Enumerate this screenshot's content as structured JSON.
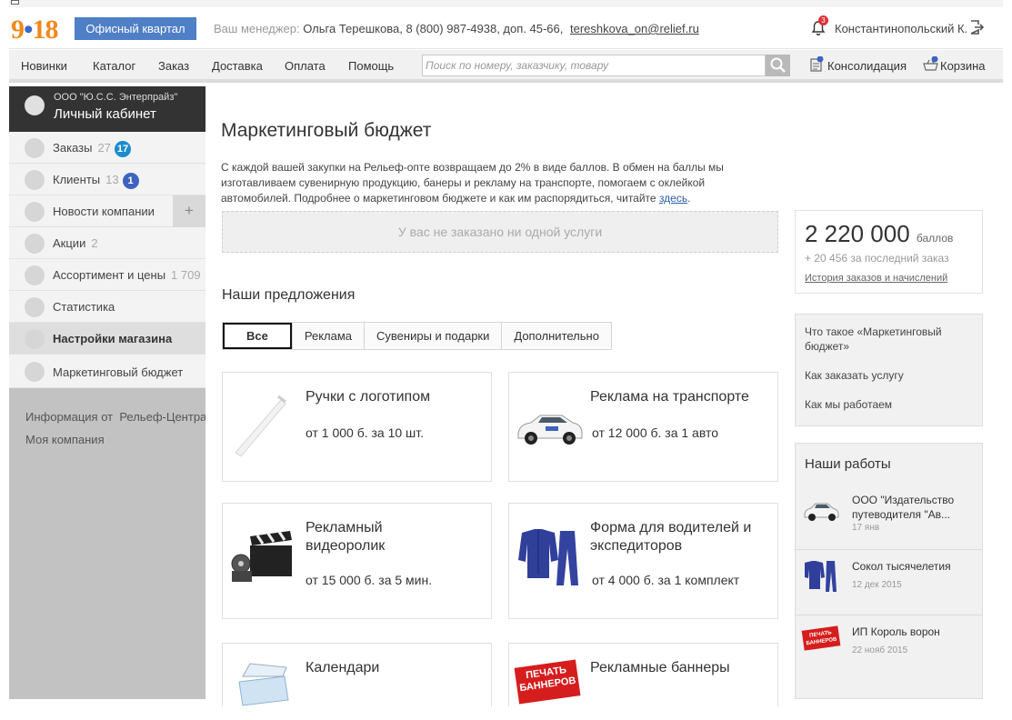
{
  "header": {
    "logo": {
      "left": "9",
      "dot": "•",
      "right": "18"
    },
    "quarter_button": "Офисный квартал",
    "manager_label": "Ваш менеджер:",
    "manager_info": "Ольга Терешкова, 8 (800) 987-4938, доп. 45-66,",
    "manager_email": "tereshkova_on@relief.ru",
    "notifications_count": "3",
    "user_name": "Константинопольский К."
  },
  "nav": {
    "items": [
      "Новинки",
      "Каталог",
      "Заказ",
      "Доставка",
      "Оплата",
      "Помощь"
    ],
    "search_placeholder": "Поиск по номеру, заказчику, товару",
    "consolidation": "Консолидация",
    "cart": "Корзина"
  },
  "sidebar": {
    "org": "ООО \"Ю.С.С. Энтерпрайз\"",
    "cabinet": "Личный кабинет",
    "items": [
      {
        "label": "Заказы",
        "count": "27",
        "badge": "17",
        "badge_color": "#1b8ccd"
      },
      {
        "label": "Клиенты",
        "count": "13",
        "badge": "1",
        "badge_color": "#3d63c0"
      },
      {
        "label": "Новости компании",
        "count": "",
        "badge": ""
      },
      {
        "label": "Акции",
        "count": "2",
        "badge": ""
      },
      {
        "label": "Ассортимент и цены",
        "count": "1 709",
        "badge": ""
      },
      {
        "label": "Статистика",
        "count": "",
        "badge": ""
      },
      {
        "label": "Настройки магазина",
        "count": "",
        "badge": ""
      },
      {
        "label": "Маркетинговый бюджет",
        "count": "",
        "badge": ""
      }
    ],
    "plus": "+",
    "footer_info": "Информация от  Рельеф-Центра",
    "footer_company": "Моя компания"
  },
  "main": {
    "title": "Маркетинговый бюджет",
    "intro": "С каждой вашей закупки на Рельеф-опте возвращаем до 2% в виде баллов. В обмен на баллы мы изготавливаем сувенирную продукцию, банеры и рекламу на транспорте, помогаем с оклейкой автомобилей. Подробнее о маркетинговом бюджете и как им распорядиться, читайте",
    "intro_link": "здесь",
    "empty": "У вас не заказано ни одной услуги",
    "offers_title": "Наши предложения",
    "tabs": [
      "Все",
      "Реклама",
      "Сувениры и подарки",
      "Дополнительно"
    ],
    "cards": [
      {
        "title": "Ручки с логотипом",
        "price": "от 1 000 б. за 10 шт.",
        "icon": "pen-icon"
      },
      {
        "title": "Реклама на транспорте",
        "price": "от 12 000 б. за 1 авто",
        "icon": "car-icon"
      },
      {
        "title": "Рекламный видеоролик",
        "price": "от 15 000 б. за 5 мин.",
        "icon": "clapperboard-icon"
      },
      {
        "title": "Форма для водителей и экспедиторов",
        "price": "от 4 000 б. за 1 комплект",
        "icon": "uniform-icon"
      },
      {
        "title": "Календари",
        "price": "",
        "icon": "calendar-icon"
      },
      {
        "title": "Рекламные баннеры",
        "price": "",
        "icon": "banner-icon"
      }
    ]
  },
  "points": {
    "value": "2 220 000",
    "unit": "баллов",
    "added": "+ 20 456 за последний заказ",
    "history": "История заказов и начислений"
  },
  "faq": [
    "Что такое «Маркетинговый бюджет»",
    "Как заказать услугу",
    "Как мы работаем"
  ],
  "works": {
    "title": "Наши работы",
    "items": [
      {
        "title": "ООО \"Издательство путеводителя \"Ав...",
        "date": "17 янв"
      },
      {
        "title": "Сокол тысячелетия",
        "date": "12 дек 2015"
      },
      {
        "title": "ИП Король ворон",
        "date": "22 нояб 2015"
      }
    ],
    "banner_text_1": "ПЕЧАТЬ",
    "banner_text_2": "БАННЕРОВ"
  }
}
